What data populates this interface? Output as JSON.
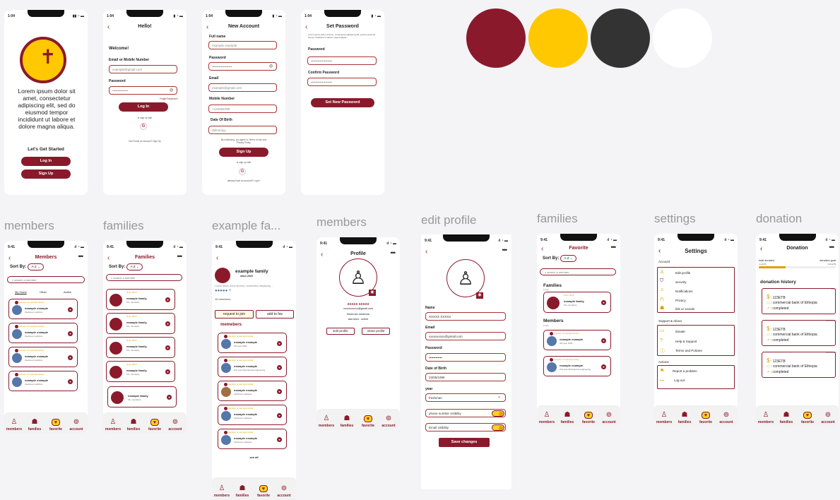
{
  "palette": [
    "#8a1a2b",
    "#ffc800",
    "#333333",
    "#ffffff"
  ],
  "labels": {
    "members1": "members",
    "families1": "families",
    "example": "example fa...",
    "members2": "members",
    "edit": "edit profile",
    "families2": "families",
    "settings": "settings",
    "donation": "donation"
  },
  "landing": {
    "status": "1:04",
    "lorem": "Lorem ipsum dolor sit amet, consectetur adipiscing elit, sed do eiusmod tempor incididunt ut labore et dolore magna aliqua.",
    "started": "Let's Get Started",
    "login": "Log In",
    "signup": "Sign Up"
  },
  "login": {
    "status": "1:04",
    "title": "Hello!",
    "welcome": "Welcome!",
    "email_label": "Email or Mobile Number",
    "email_ph": "example@gmail.com",
    "password_label": "Password",
    "password_ph": "••••••••••••••",
    "forgot": "Forget Password?",
    "btn": "Log In",
    "or": "or sign up with",
    "no_account": "Don't have an account? Sign Up"
  },
  "signup": {
    "status": "1:04",
    "title": "New Account",
    "full_name": "Full name",
    "full_name_ph": "example example",
    "password": "Password",
    "password_ph": "••••••••••••••••••",
    "email": "Email",
    "email_ph": "example@gmail.com",
    "mobile": "Mobile Number",
    "mobile_ph": "+123456789",
    "dob": "Date Of Birth",
    "dob_ph": "dd/mm/yy",
    "terms": "By continuing, you agree to Terms of Use and Privacy Policy.",
    "btn": "Sign Up",
    "or": "or sign up with",
    "have": "already have an account? Log in"
  },
  "setpw": {
    "status": "1:04",
    "title": "Set Password",
    "desc": "Lorem ipsum dolor sit amet, consectetur adipiscing elit, sed do eiusmod tempor incididunt ut labore magna aliqua.",
    "password": "Password",
    "password_ph": "•••••••••••••••••••",
    "confirm": "Confirm Password",
    "confirm_ph": "•••••••••••••••••••",
    "btn": "Set New Password"
  },
  "members": {
    "status": "9:41",
    "title": "Members",
    "sort": "Sort By:",
    "sort_val": "A-Z",
    "search": "search a member",
    "tabs": [
      "My Clans",
      "Other",
      "Active"
    ],
    "rows": [
      {
        "tag": "member of example family",
        "name": "example example",
        "sub": "freshman medicine"
      },
      {
        "tag": "member of example family",
        "name": "example example",
        "sub": "freshman medicine"
      },
      {
        "tag": "member of example family",
        "name": "example example",
        "sub": "freshman medicine"
      },
      {
        "tag": "member of example family",
        "name": "example example",
        "sub": "freshman medicine"
      }
    ]
  },
  "families": {
    "status": "9:41",
    "title": "Families",
    "sort": "Sort By:",
    "sort_val": "A-Z",
    "search": "search a member",
    "rows": [
      {
        "tag": "since 2015",
        "name": "example family",
        "sub": "15+ members"
      },
      {
        "tag": "since 2015",
        "name": "example family",
        "sub": "15+ members"
      },
      {
        "tag": "since 2015",
        "name": "example family",
        "sub": "15+ members"
      },
      {
        "tag": "since 2015",
        "name": "example family",
        "sub": "15+ members"
      },
      {
        "tag": "",
        "name": "example family",
        "sub": "15+ members"
      }
    ]
  },
  "exfam": {
    "status": "9:41",
    "name": "example family",
    "since": "since 2015",
    "desc": "Lorem ipsum dolor sit amet, consectetur adipiscing ...",
    "count": "10 members",
    "join": "request to join",
    "fav": "add to fav",
    "section": "memebers",
    "seeall": "see all",
    "rows": [
      {
        "tag": "member of example family",
        "name": "example example",
        "sub": "3rd year CMC"
      },
      {
        "tag": "member of example family",
        "name": "example example",
        "sub": "2nd year Mechanical engineering"
      },
      {
        "tag": "member of example family",
        "name": "example example",
        "sub": "freshman medicine"
      },
      {
        "tag": "member of example family",
        "name": "example example",
        "sub": "freshman medicine"
      },
      {
        "tag": "member of example family",
        "name": "example example",
        "sub": "freshman medicine"
      }
    ]
  },
  "profile": {
    "status": "9:41",
    "title": "Profile",
    "name": "XXXXX XXXXX",
    "email": "xxxxxxxxxxx@gmail.com",
    "dept": "freshman medicine",
    "last": "last seen : online",
    "edit": "Edit profile",
    "share": "share profile"
  },
  "editp": {
    "status": "9:41",
    "name_l": "Name",
    "name_v": "XXXXX XXXXX",
    "email_l": "Email",
    "email_v": "xxxxxxxxxx@gmail.com",
    "pw_l": "Password",
    "pw_v": "••••••••••••",
    "dob_l": "Date of Birth",
    "dob_v": "23/05/1995",
    "year_l": "year",
    "year_v": "freshman",
    "phone": "phone number visibility",
    "emailvis": "Email visibility",
    "btn": "Save changes"
  },
  "favorite": {
    "status": "9:41",
    "title": "Favorite",
    "sort": "Sort By:",
    "sort_val": "A-Z",
    "search": "search a member",
    "fam_h": "Families",
    "fam_sub": "1 item",
    "mem_h": "Members",
    "mem_sub": "2 item",
    "fam": {
      "tag": "since 2015",
      "name": "example family",
      "sub": "15+ members"
    },
    "mems": [
      {
        "tag": "member of example family",
        "name": "example example",
        "sub": "3rd year CMC"
      },
      {
        "tag": "member of example family",
        "name": "example example",
        "sub": "2nd year Mechanical engineering"
      }
    ]
  },
  "settings": {
    "status": "9:41",
    "title": "Settings",
    "account": "Account",
    "acc_items": [
      "Edit profile",
      "security",
      "Notifications",
      "Privacy",
      "link ur socials"
    ],
    "support": "Support & About",
    "sup_items": [
      "donate",
      "Help & Support",
      "Terms and Policies"
    ],
    "actions": "Actions",
    "act_items": [
      "Report a problem",
      "Log out"
    ]
  },
  "donation": {
    "status": "9:41",
    "title": "Donation",
    "total_l": "total donated",
    "total_v": "xxxETB",
    "goal_l": "donation goal",
    "goal_v": "10k ETB",
    "progress": 0.35,
    "history": "donation history",
    "items": [
      {
        "date": "today",
        "amount": "123ETB",
        "bank": "commercial bank of Ethiopia",
        "status": "completed"
      },
      {
        "date": "23/04/2025",
        "amount": "123ETB",
        "bank": "commercial bank of Ethiopia",
        "status": "completed"
      },
      {
        "date": "23/03/2025",
        "amount": "123ETB",
        "bank": "commercial bank of Ethiopia",
        "status": "completed"
      }
    ]
  },
  "nav": {
    "members": "members",
    "families": "families",
    "favorite": "favorite",
    "account": "account"
  }
}
